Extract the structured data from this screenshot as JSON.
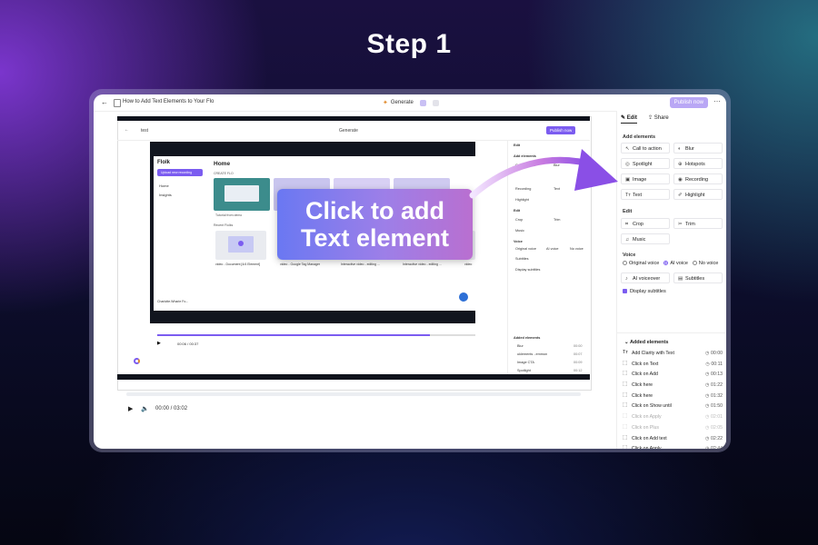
{
  "step_title": "Step 1",
  "callout": {
    "line1": "Click to add",
    "line2": "Text element"
  },
  "topbar": {
    "back_icon": "arrow-left-icon",
    "title": "How to Add Text Elements to Your Flo",
    "generate_label": "Generate",
    "publish_label": "Publish now",
    "more_icon": "ellipsis-icon"
  },
  "inner": {
    "title": "test",
    "generate_label": "Generate",
    "publish_label": "Publish now",
    "app_name": "Flolk",
    "upload_label": "Upload new recording",
    "side_items": [
      "Home",
      "Insights"
    ],
    "home_title": "Home",
    "create_label": "CREATE FLO",
    "recent_label": "Recent Flolks",
    "card_caption": "Tutorial from demo",
    "video_captions": [
      "video - Document [4/4 Element]",
      "video - Google Tag Manager",
      "Interactive video - editing ...",
      "Interactive video - editing ...",
      "video"
    ],
    "user_name": "Charlotte.Wharle Fo...",
    "time": "00:06 / 00:37",
    "panel": {
      "edit_tab": "Edit",
      "add_elements": "Add elements",
      "items": [
        "Call to action",
        "Blur",
        "Recording",
        "Text",
        "Highlight"
      ],
      "edit": "Edit",
      "edit_items": [
        "Crop",
        "Trim",
        "Music"
      ],
      "voice": "Voice",
      "voice_opts": [
        "Original voice",
        "AI voice",
        "No voice"
      ],
      "subtitles": "Subtitles",
      "display_subtitles": "Display subtitles",
      "added": "Added elements",
      "added_items": [
        {
          "name": "Blur",
          "time": "00:00"
        },
        {
          "name": "uklements ..emmon",
          "time": "00:07"
        },
        {
          "name": "Image CTA",
          "time": "00:09"
        },
        {
          "name": "Spotlight",
          "time": "00:12"
        }
      ]
    }
  },
  "player": {
    "time": "00:00 / 03:02"
  },
  "panel": {
    "tab_edit": "Edit",
    "tab_share": "Share",
    "add_elements_heading": "Add elements",
    "elements": {
      "call_to_action": "Call to action",
      "blur": "Blur",
      "spotlight": "Spotlight",
      "hotspots": "Hotspots",
      "image": "Image",
      "recording": "Recording",
      "text": "Text",
      "highlight": "Highlight"
    },
    "edit_heading": "Edit",
    "crop": "Crop",
    "trim": "Trim",
    "music": "Music",
    "voice_heading": "Voice",
    "voice_original": "Original voice",
    "voice_ai": "AI voice",
    "voice_none": "No voice",
    "ai_voiceover": "AI voiceover",
    "subtitles": "Subtitles",
    "display_subtitles": "Display subtitles",
    "added_heading": "Added elements",
    "added": [
      {
        "name": "Add Clarity with Text",
        "time": "00:00",
        "dim": false
      },
      {
        "name": "Click on Text",
        "time": "00:11",
        "dim": false
      },
      {
        "name": "Click on Add",
        "time": "00:13",
        "dim": false
      },
      {
        "name": "Click here",
        "time": "01:22",
        "dim": false
      },
      {
        "name": "Click here",
        "time": "01:32",
        "dim": false
      },
      {
        "name": "Click on Show until",
        "time": "01:50",
        "dim": false
      },
      {
        "name": "Click on Apply",
        "time": "02:01",
        "dim": true
      },
      {
        "name": "Click on Plus",
        "time": "02:05",
        "dim": true
      },
      {
        "name": "Click on Add text",
        "time": "02:22",
        "dim": false
      },
      {
        "name": "Click on Apply",
        "time": "02:44",
        "dim": false
      }
    ]
  },
  "colors": {
    "accent": "#7b5cf0",
    "publish": "#b9a7f5",
    "callout_start": "#6a78f2",
    "callout_end": "#b96fd0"
  }
}
